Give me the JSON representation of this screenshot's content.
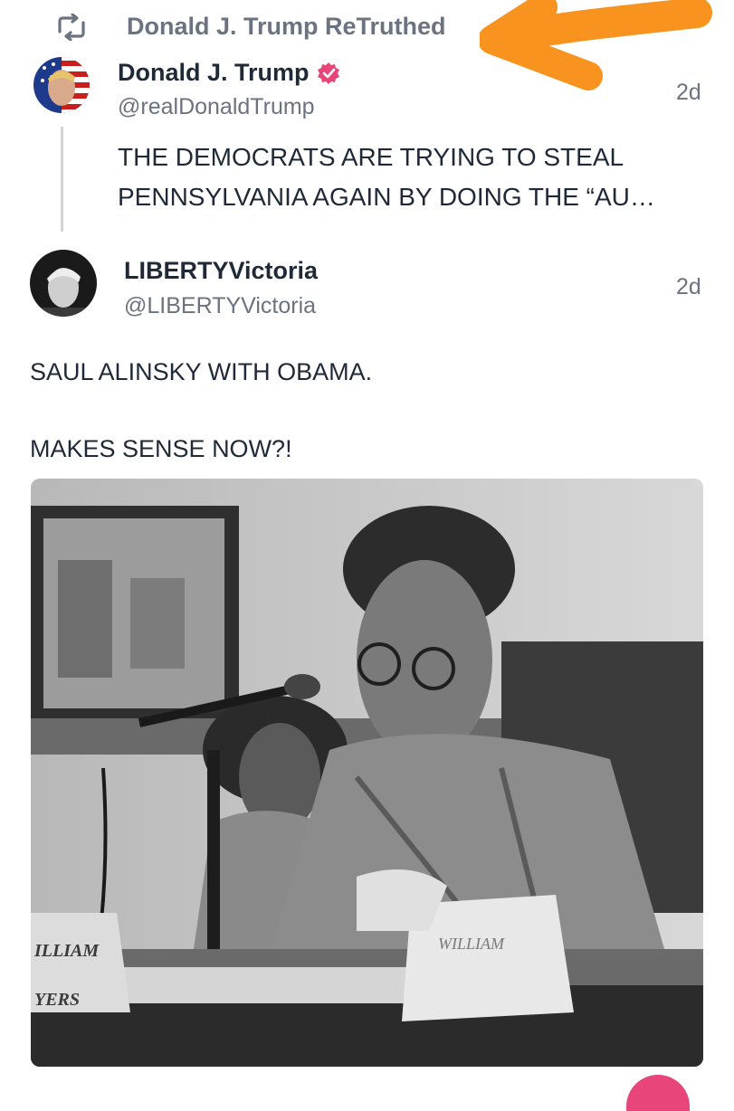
{
  "retruth": {
    "label": "Donald J. Trump ReTruthed",
    "icon": "retruth-icon"
  },
  "original_post": {
    "author_name": "Donald J. Trump",
    "handle": "@realDonaldTrump",
    "time": "2d",
    "text": "THE DEMOCRATS ARE TRYING TO STEAL PENNSYLVANIA AGAIN BY DOING THE “AU…",
    "verified_icon": "verified-badge-icon"
  },
  "reply_post": {
    "author_name": "LIBERTYVictoria",
    "handle": "@LIBERTYVictoria",
    "time": "2d",
    "text_line1": "SAUL ALINSKY WITH OBAMA.",
    "text_line2": "MAKES SENSE NOW?!"
  },
  "photo": {
    "placard_left_line1": "ILLIAM",
    "placard_left_line2": "YERS",
    "placard_center": "WILLIAM"
  },
  "colors": {
    "annotation_arrow": "#f7931e",
    "verified_badge": "#e8457a",
    "muted_text": "#6b7280",
    "body_text": "#1f2937"
  }
}
